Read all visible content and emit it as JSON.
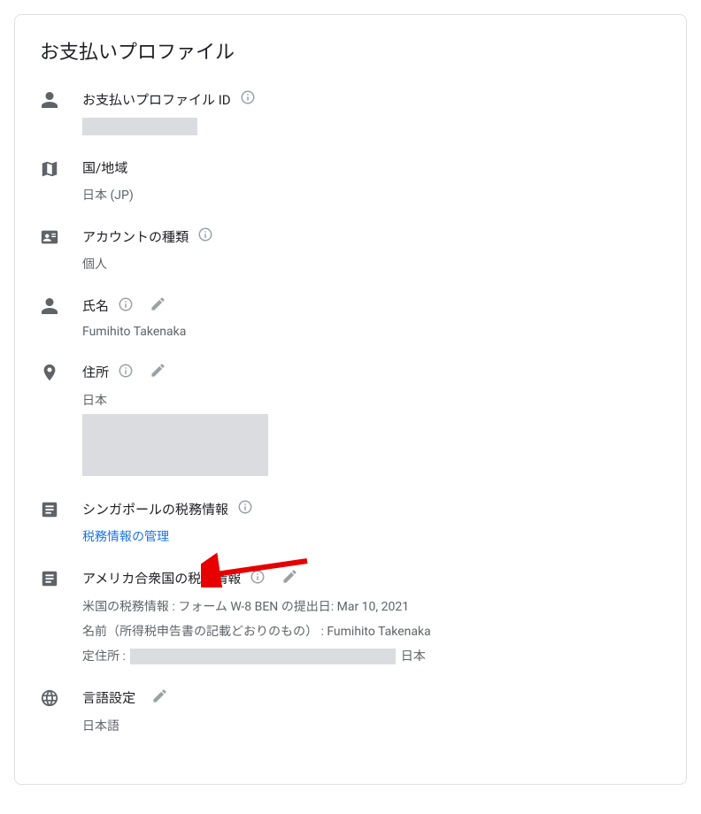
{
  "header": {
    "title": "お支払いプロファイル"
  },
  "rows": {
    "profile_id": {
      "label": "お支払いプロファイル ID"
    },
    "country": {
      "label": "国/地域",
      "value": "日本 (JP)"
    },
    "account_type": {
      "label": "アカウントの種類",
      "value": "個人"
    },
    "name": {
      "label": "氏名",
      "value": "Fumihito Takenaka"
    },
    "address": {
      "label": "住所",
      "value_line1": "日本"
    },
    "sg_tax": {
      "label": "シンガポールの税務情報",
      "link": "税務情報の管理"
    },
    "us_tax": {
      "label": "アメリカ合衆国の税務情報",
      "line1": "米国の税務情報 : フォーム W-8 BEN の提出日: Mar 10, 2021",
      "line2": "名前（所得税申告書の記載どおりのもの） : Fumihito Takenaka",
      "line3_prefix": "定住所 :",
      "line3_suffix": "日本"
    },
    "language": {
      "label": "言語設定",
      "value": "日本語"
    }
  }
}
